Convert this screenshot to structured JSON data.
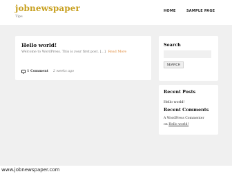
{
  "header": {
    "site_title": "jobnewspaper",
    "tagline": "Tips",
    "nav": [
      {
        "label": "HOME"
      },
      {
        "label": "SAMPLE PAGE"
      }
    ]
  },
  "post": {
    "title": "Hello world!",
    "excerpt": "Welcome to WordPress. This is your first post.",
    "ellipsis": "[...]",
    "read_more": "Read More",
    "comments": "1 Comment",
    "date": "2 weeks ago"
  },
  "search_widget": {
    "title": "Search",
    "input_value": "",
    "button_label": "SEARCH"
  },
  "recent_posts_widget": {
    "title": "Recent Posts",
    "items": [
      {
        "label": "Hello world!"
      }
    ]
  },
  "recent_comments_widget": {
    "title": "Recent Comments",
    "author": "A WordPress Commenter",
    "on": "on",
    "post_link": "Hello world!"
  },
  "footer": {
    "text": "www.jobnewspaper.com"
  }
}
